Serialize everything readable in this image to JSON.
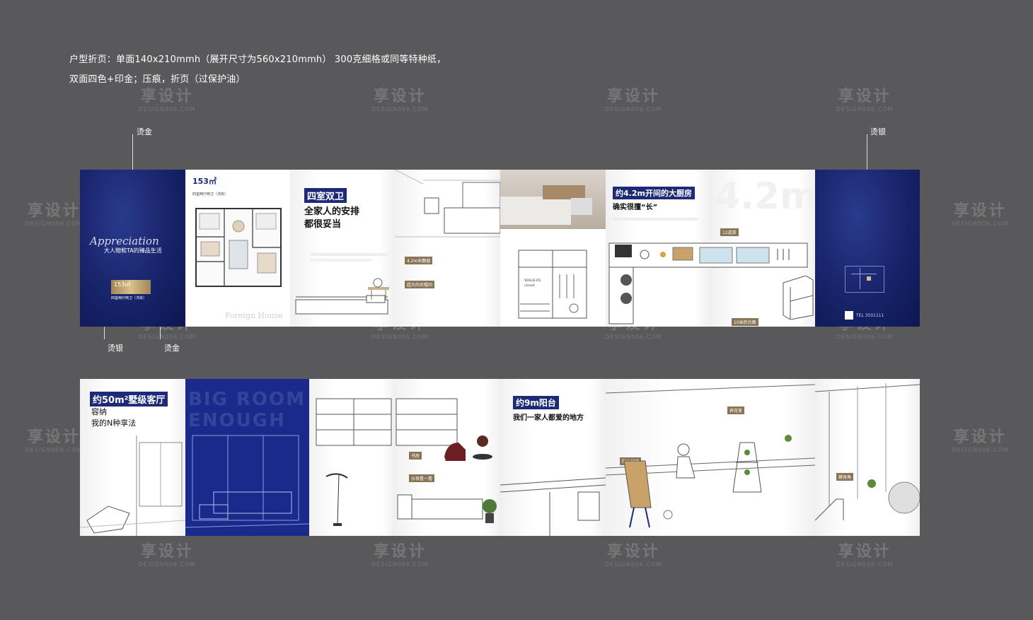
{
  "spec": {
    "line1": "户型折页：单面140x210mmh（展开尺寸为560x210mmh） 300克细格或同等特种纸，",
    "line2": "双面四色+印金；压痕，折页（过保护油）"
  },
  "callouts": {
    "top_left": "烫金",
    "top_right": "烫银",
    "bottom_left_a": "烫银",
    "bottom_left_b": "烫金"
  },
  "watermark": {
    "brand": "享设计",
    "site": "DESIGN006.COM"
  },
  "top_strip": {
    "cover": {
      "script": "Appreciation",
      "tagline": "大人物和TA的臻品生活",
      "badge_num": "153㎡",
      "badge_sub": "四室两厅两卫（洋房）"
    },
    "plan": {
      "area": "153㎡",
      "type": "四室两厅两卫（洋房）",
      "footer": "Foreign House"
    },
    "bedroom": {
      "title": "四室双卫",
      "line1": "全家人的安排",
      "line2": "都很妥当",
      "tag1": "4.2m长飘窗",
      "tag2": "超大的衣帽间",
      "walkin": "WALK-IN",
      "closet": "closet"
    },
    "kitchen": {
      "title": "约4.2m开间的大厨房",
      "subtitle": "确实很擅“长”",
      "big": "4.2m",
      "tag1": "12道菜",
      "tag2": "10米的台面"
    },
    "back": {
      "contact": "TEL 3501111"
    }
  },
  "bottom_strip": {
    "living": {
      "title": "约50m²墅级客厅",
      "line1": "容纳",
      "line2": "我的N种享法",
      "deco": "BIG ROOM ENOUGH"
    },
    "study": {
      "tag1": "书房",
      "tag2": "沙发看一看"
    },
    "balcony": {
      "title": "约9m阳台",
      "subtitle": "我们一家人都爱的地方",
      "tag1": "阳台晾晒",
      "tag2": "养花草",
      "tag3": "健身角"
    }
  },
  "colors": {
    "background": "#59585a",
    "navy": "#1d2a78",
    "gold": "#8a7457"
  }
}
